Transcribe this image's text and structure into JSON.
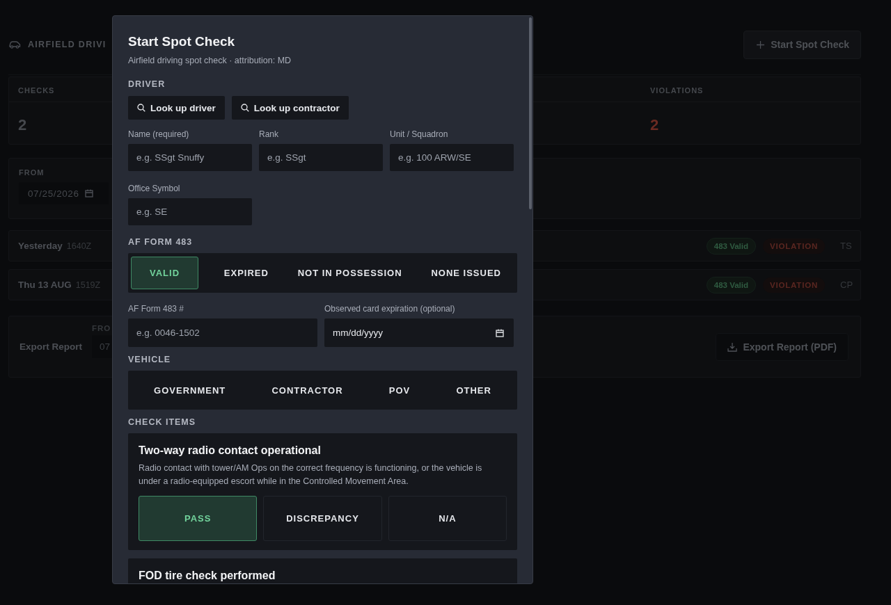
{
  "background": {
    "title": "AIRFIELD DRIVI",
    "start_button": "Start Spot Check",
    "stats": [
      {
        "label": "CHECKS",
        "value": "2",
        "kind": "plain"
      },
      {
        "label": "VIOLATIONS",
        "value": "2",
        "kind": "alert"
      }
    ],
    "filter": {
      "label": "FROM",
      "value": "07/25/2026"
    },
    "records": [
      {
        "day": "Yesterday",
        "time": "1640Z",
        "badges": [
          {
            "text": "483 Valid",
            "kind": "ok"
          },
          {
            "text": "VIOLATION",
            "kind": "violation"
          }
        ],
        "initials": "TS"
      },
      {
        "day": "Thu 13 AUG",
        "time": "1519Z",
        "badges": [
          {
            "text": "483 Valid",
            "kind": "ok"
          },
          {
            "text": "VIOLATION",
            "kind": "violation"
          }
        ],
        "initials": "CP"
      }
    ],
    "export": {
      "label": "Export Report",
      "from_label": "FRO",
      "from_value": "07",
      "button": "Export Report (PDF)"
    }
  },
  "modal": {
    "title": "Start Spot Check",
    "subtitle": "Airfield driving spot check · attribution: MD",
    "driver_label": "DRIVER",
    "lookup_buttons": [
      "Look up driver",
      "Look up contractor"
    ],
    "driver_fields": [
      {
        "label": "Name (required)",
        "placeholder": "e.g. SSgt Snuffy"
      },
      {
        "label": "Rank",
        "placeholder": "e.g. SSgt"
      },
      {
        "label": "Unit / Squadron",
        "placeholder": "e.g. 100 ARW/SE"
      },
      {
        "label": "Office Symbol",
        "placeholder": "e.g. SE"
      }
    ],
    "form_label": "AF FORM 483",
    "form_options": [
      {
        "label": "VALID",
        "selected": true
      },
      {
        "label": "EXPIRED",
        "selected": false
      },
      {
        "label": "NOT IN POSSESSION",
        "selected": false
      },
      {
        "label": "NONE ISSUED",
        "selected": false
      }
    ],
    "form_fields": [
      {
        "label": "AF Form 483 #",
        "placeholder": "e.g. 0046-1502",
        "kind": "text"
      },
      {
        "label": "Observed card expiration (optional)",
        "placeholder": "mm/dd/yyyy",
        "kind": "date"
      }
    ],
    "vehicle_label": "VEHICLE",
    "vehicle_options": [
      {
        "label": "GOVERNMENT",
        "selected": false
      },
      {
        "label": "CONTRACTOR",
        "selected": false
      },
      {
        "label": "POV",
        "selected": false
      },
      {
        "label": "OTHER",
        "selected": false
      }
    ],
    "check_label": "CHECK ITEMS",
    "check_items": [
      {
        "title": "Two-way radio contact operational",
        "description": "Radio contact with tower/AM Ops on the correct frequency is functioning, or the vehicle is under a radio-equipped escort while in the Controlled Movement Area.",
        "options": [
          {
            "label": "PASS",
            "selected": true
          },
          {
            "label": "DISCREPANCY",
            "selected": false
          },
          {
            "label": "N/A",
            "selected": false
          }
        ]
      },
      {
        "title": "FOD tire check performed"
      }
    ]
  }
}
